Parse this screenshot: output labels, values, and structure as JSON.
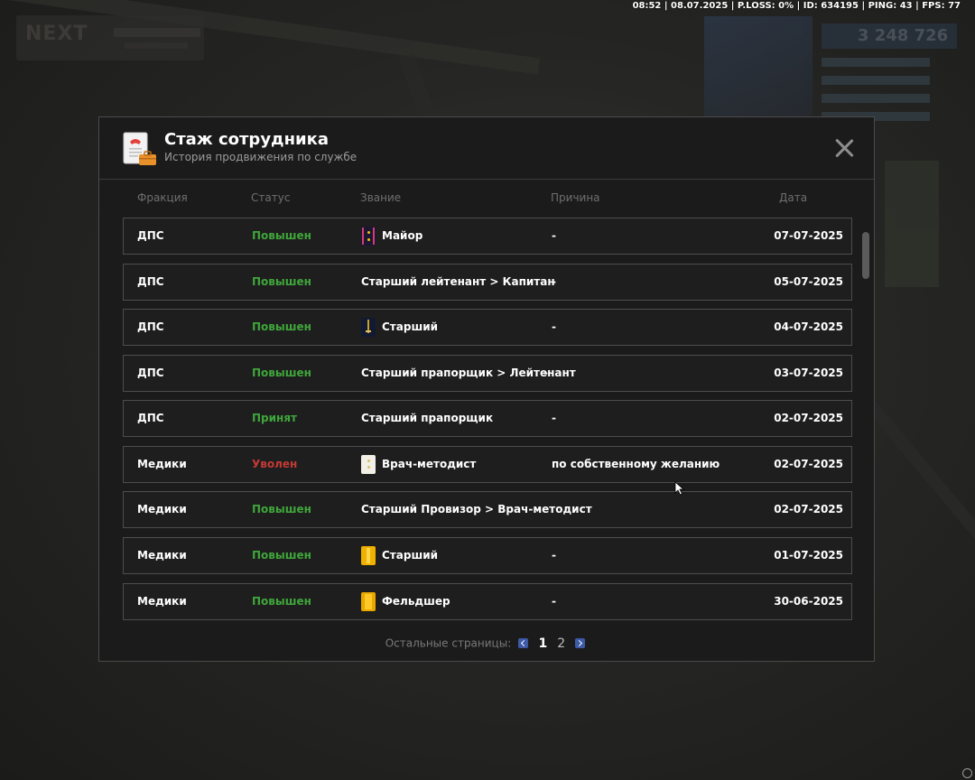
{
  "status_bar": {
    "text": "08:52 | 08.07.2025 | P.LOSS: 0% | ID: 634195 | PING: 43 | FPS: 77"
  },
  "background": {
    "logo_text": "NEXT",
    "money": "3 248 726"
  },
  "modal": {
    "title": "Стаж сотрудника",
    "subtitle": "История продвижения по службе",
    "header_icon": "document-briefcase-icon",
    "close_icon": "close-icon"
  },
  "columns": {
    "faction": "Фракция",
    "status": "Статус",
    "rank": "Звание",
    "reason": "Причина",
    "date": "Дата"
  },
  "rows": [
    {
      "faction": "ДПС",
      "status": "Повышен",
      "status_type": "promoted",
      "rank": "Майор",
      "rank_icon": "major-insignia-icon",
      "reason": "-",
      "date": "07-07-2025"
    },
    {
      "faction": "ДПС",
      "status": "Повышен",
      "status_type": "promoted",
      "rank": "Старший лейтенант > Капитан",
      "rank_icon": "",
      "reason": "-",
      "date": "05-07-2025"
    },
    {
      "faction": "ДПС",
      "status": "Повышен",
      "status_type": "promoted",
      "rank": "Старший",
      "rank_icon": "senior-insignia-icon",
      "reason": "-",
      "date": "04-07-2025"
    },
    {
      "faction": "ДПС",
      "status": "Повышен",
      "status_type": "promoted",
      "rank": "Старший прапорщик > Лейтенант",
      "rank_icon": "",
      "reason": "-",
      "date": "03-07-2025"
    },
    {
      "faction": "ДПС",
      "status": "Принят",
      "status_type": "accepted",
      "rank": "Старший прапорщик",
      "rank_icon": "",
      "reason": "-",
      "date": "02-07-2025"
    },
    {
      "faction": "Медики",
      "status": "Уволен",
      "status_type": "fired",
      "rank": "Врач-методист",
      "rank_icon": "medic-white-insignia-icon",
      "reason": "по собственному желанию",
      "date": "02-07-2025"
    },
    {
      "faction": "Медики",
      "status": "Повышен",
      "status_type": "promoted",
      "rank": "Старший Провизор > Врач-методист",
      "rank_icon": "",
      "reason": "",
      "date": "02-07-2025"
    },
    {
      "faction": "Медики",
      "status": "Повышен",
      "status_type": "promoted",
      "rank": "Старший",
      "rank_icon": "medic-gold-insignia-icon",
      "reason": "-",
      "date": "01-07-2025"
    },
    {
      "faction": "Медики",
      "status": "Повышен",
      "status_type": "promoted",
      "rank": "Фельдшер",
      "rank_icon": "medic-gold2-insignia-icon",
      "reason": "-",
      "date": "30-06-2025"
    }
  ],
  "pagination": {
    "label": "Остальные страницы:",
    "pages": [
      "1",
      "2"
    ],
    "current_page": "1"
  },
  "colors": {
    "promoted": "#3fa63b",
    "fired": "#c43a35",
    "page_arrow": "#3d5aa8"
  }
}
